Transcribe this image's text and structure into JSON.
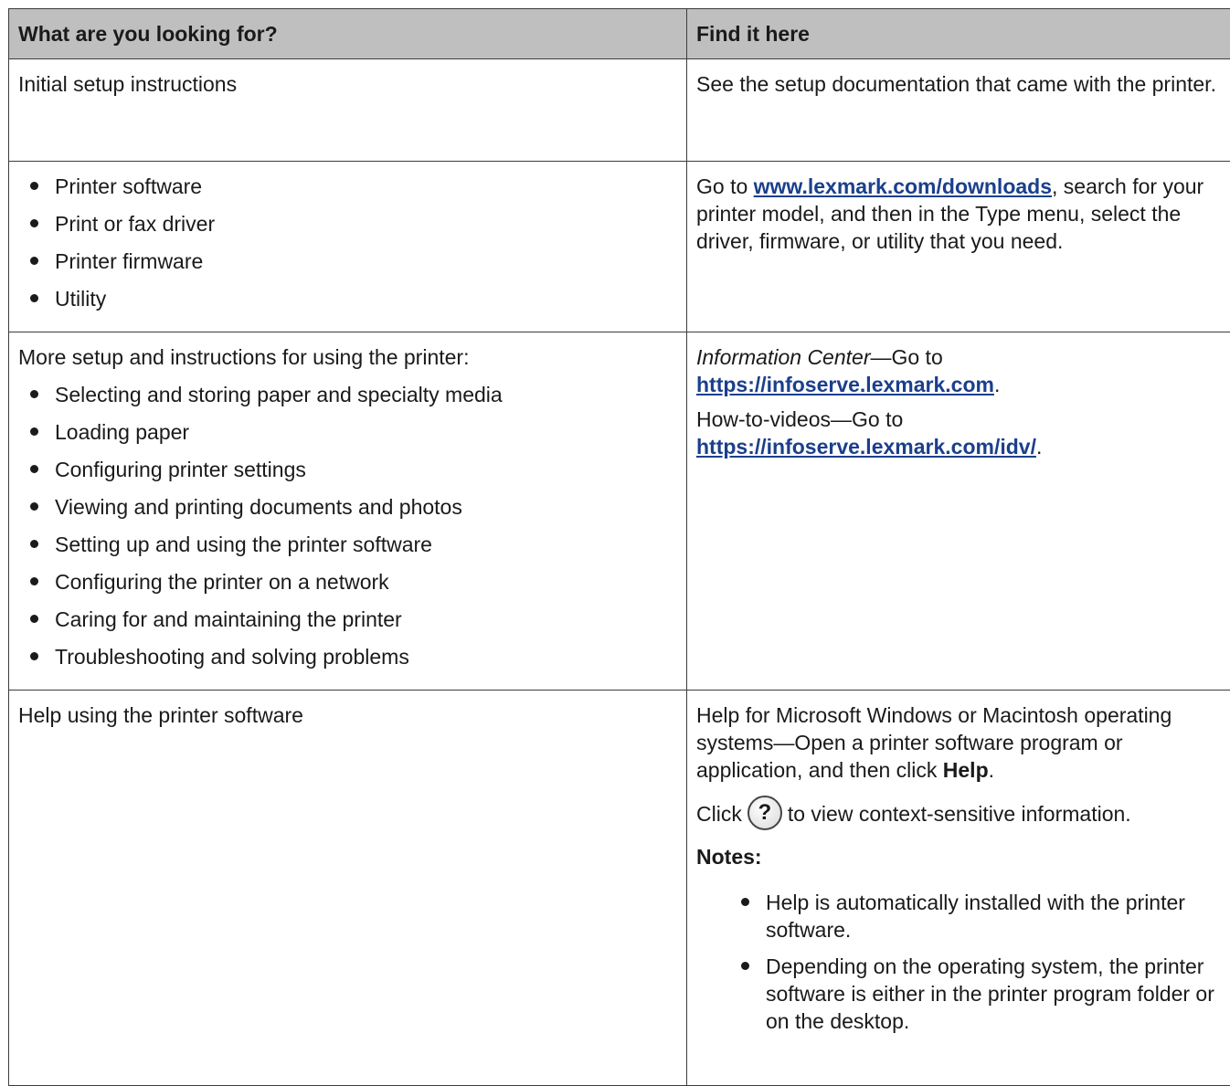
{
  "header": {
    "col1": "What are you looking for?",
    "col2": "Find it here"
  },
  "rows": [
    {
      "left": "Initial setup instructions",
      "right": "See the setup documentation that came with the printer."
    },
    {
      "left_items": [
        "Printer software",
        "Print or fax driver",
        "Printer firmware",
        "Utility"
      ],
      "right_before": "Go to ",
      "right_link": "www.lexmark.com/downloads",
      "right_after": ", search for your printer model, and then in the Type menu, select the driver, firmware, or utility that you need."
    },
    {
      "left_intro": "More setup and instructions for using the printer:",
      "left_items": [
        "Selecting and storing paper and specialty media",
        "Loading paper",
        "Configuring printer settings",
        "Viewing and printing documents and photos",
        "Setting up and using the printer software",
        "Configuring the printer on a network",
        "Caring for and maintaining the printer",
        "Troubleshooting and solving problems"
      ],
      "right_p1_ital": "Information Center",
      "right_p1_text": "—Go to ",
      "right_p1_link": "https://infoserve.lexmark.com",
      "right_p1_end": ".",
      "right_p2_text": "How-to-videos—Go to ",
      "right_p2_link": "https://infoserve.lexmark.com/idv/",
      "right_p2_end": "."
    },
    {
      "left": "Help using the printer software",
      "right_p1": "Help for Microsoft Windows or Macintosh operating systems—Open a printer software program or application, and then click ",
      "right_p1_bold": "Help",
      "right_p1_end": ".",
      "right_p2_before": "Click",
      "right_p2_icon_glyph": "?",
      "right_p2_after": "to view context-sensitive information.",
      "notes_title": "Notes:",
      "notes": [
        "Help is automatically installed with the printer software.",
        "Depending on the operating system, the printer software is either in the printer program folder or on the desktop."
      ]
    }
  ]
}
